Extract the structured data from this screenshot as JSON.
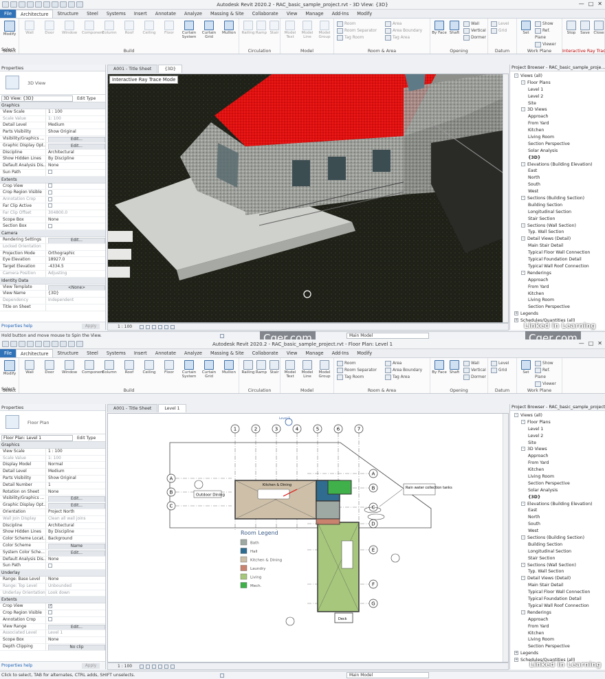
{
  "top": {
    "title": "Autodesk Revit 2020.2 - RAC_basic_sample_project.rvt - 3D View: {3D}",
    "tabs": [
      "File",
      "Architecture",
      "Structure",
      "Steel",
      "Systems",
      "Insert",
      "Annotate",
      "Analyze",
      "Massing & Site",
      "Collaborate",
      "View",
      "Manage",
      "Add-Ins",
      "Modify"
    ],
    "select_label": "Select",
    "modify_label": "Modify",
    "build_tools": [
      "Wall",
      "Door",
      "Window",
      "Component",
      "Column",
      "Roof",
      "Ceiling",
      "Floor",
      "Curtain System",
      "Curtain Grid",
      "Mullion"
    ],
    "build_label": "Build",
    "circ_tools": [
      "Railing",
      "Ramp",
      "Stair"
    ],
    "circ_label": "Circulation",
    "model_tools": [
      "Model Text",
      "Model Line",
      "Model Group"
    ],
    "model_label": "Model",
    "room_small": [
      "Room",
      "Room Separator",
      "Tag Room"
    ],
    "area_small": [
      "Area",
      "Area Boundary",
      "Tag Area"
    ],
    "room_label": "Room & Area",
    "opening_tools": [
      "By Face",
      "Shaft"
    ],
    "opening_small": [
      "Wall",
      "Vertical",
      "Dormer"
    ],
    "opening_label": "Opening",
    "datum_small": [
      "Level",
      "Grid"
    ],
    "datum_label": "Datum",
    "wp_tools": [
      "Set"
    ],
    "wp_small": [
      "Show",
      "Ref. Plane",
      "Viewer"
    ],
    "wp_label": "Work Plane",
    "irt_tools": [
      "Stop",
      "Save",
      "Close"
    ],
    "irt_label": "Interactive Ray Trace",
    "properties_title": "Properties",
    "type_name": "3D View",
    "filter": "3D View: {3D}",
    "edit_type": "Edit Type",
    "rows": [
      {
        "s": "Graphics"
      },
      {
        "k": "View Scale",
        "v": "1 : 100"
      },
      {
        "k": "Scale Value",
        "v": "1: 100",
        "d": true
      },
      {
        "k": "Detail Level",
        "v": "Medium"
      },
      {
        "k": "Parts Visibility",
        "v": "Show Original"
      },
      {
        "k": "Visibility/Graphics ...",
        "b": "Edit..."
      },
      {
        "k": "Graphic Display Opt...",
        "b": "Edit..."
      },
      {
        "k": "Discipline",
        "v": "Architectural"
      },
      {
        "k": "Show Hidden Lines",
        "v": "By Discipline"
      },
      {
        "k": "Default Analysis Dis...",
        "v": "None"
      },
      {
        "k": "Sun Path",
        "c": "off"
      },
      {
        "s": "Extents"
      },
      {
        "k": "Crop View",
        "c": "off"
      },
      {
        "k": "Crop Region Visible",
        "c": "off"
      },
      {
        "k": "Annotation Crop",
        "c": "off",
        "d": true
      },
      {
        "k": "Far Clip Active",
        "c": "off"
      },
      {
        "k": "Far Clip Offset",
        "v": "304800.0",
        "d": true
      },
      {
        "k": "Scope Box",
        "v": "None"
      },
      {
        "k": "Section Box",
        "c": "off"
      },
      {
        "s": "Camera"
      },
      {
        "k": "Rendering Settings",
        "b": "Edit..."
      },
      {
        "k": "Locked Orientation",
        "v": "",
        "d": true
      },
      {
        "k": "Projection Mode",
        "v": "Orthographic"
      },
      {
        "k": "Eye Elevation",
        "v": "18927.0"
      },
      {
        "k": "Target Elevation",
        "v": "-4334.5"
      },
      {
        "k": "Camera Position",
        "v": "Adjusting",
        "d": true
      },
      {
        "s": "Identity Data"
      },
      {
        "k": "View Template",
        "b": "<None>"
      },
      {
        "k": "View Name",
        "v": "{3D}"
      },
      {
        "k": "Dependency",
        "v": "Independent",
        "d": true
      },
      {
        "k": "Title on Sheet",
        "v": ""
      }
    ],
    "help": "Properties help",
    "apply": "Apply",
    "view_tabs": [
      "A001 - Title Sheet",
      "{3D}"
    ],
    "rt_label": "Interactive Ray Trace Mode",
    "scale": "1 : 100",
    "status": "Hold button and move mouse to Spin the View.",
    "main_model": "Main Model",
    "browser_title": "Project Browser - RAC_basic_sample_proje...",
    "tree": [
      {
        "l": 0,
        "t": "Views (all)",
        "g": "-"
      },
      {
        "l": 1,
        "t": "Floor Plans",
        "g": "-"
      },
      {
        "l": 2,
        "t": "Level 1"
      },
      {
        "l": 2,
        "t": "Level 2"
      },
      {
        "l": 2,
        "t": "Site"
      },
      {
        "l": 1,
        "t": "3D Views",
        "g": "-"
      },
      {
        "l": 2,
        "t": "Approach"
      },
      {
        "l": 2,
        "t": "From Yard"
      },
      {
        "l": 2,
        "t": "Kitchen"
      },
      {
        "l": 2,
        "t": "Living Room"
      },
      {
        "l": 2,
        "t": "Section Perspective"
      },
      {
        "l": 2,
        "t": "Solar Analysis"
      },
      {
        "l": 2,
        "t": "{3D}",
        "b": true
      },
      {
        "l": 1,
        "t": "Elevations (Building Elevation)",
        "g": "-"
      },
      {
        "l": 2,
        "t": "East"
      },
      {
        "l": 2,
        "t": "North"
      },
      {
        "l": 2,
        "t": "South"
      },
      {
        "l": 2,
        "t": "West"
      },
      {
        "l": 1,
        "t": "Sections (Building Section)",
        "g": "-"
      },
      {
        "l": 2,
        "t": "Building Section"
      },
      {
        "l": 2,
        "t": "Longitudinal Section"
      },
      {
        "l": 2,
        "t": "Stair Section"
      },
      {
        "l": 1,
        "t": "Sections (Wall Section)",
        "g": "-"
      },
      {
        "l": 2,
        "t": "Typ. Wall Section"
      },
      {
        "l": 1,
        "t": "Detail Views (Detail)",
        "g": "-"
      },
      {
        "l": 2,
        "t": "Main Stair Detail"
      },
      {
        "l": 2,
        "t": "Typical Floor Wall Connection"
      },
      {
        "l": 2,
        "t": "Typical Foundation Detail"
      },
      {
        "l": 2,
        "t": "Typical Wall Roof Connection"
      },
      {
        "l": 1,
        "t": "Renderings",
        "g": "-"
      },
      {
        "l": 2,
        "t": "Approach"
      },
      {
        "l": 2,
        "t": "From Yard"
      },
      {
        "l": 2,
        "t": "Kitchen"
      },
      {
        "l": 2,
        "t": "Living Room"
      },
      {
        "l": 2,
        "t": "Section Perspective"
      },
      {
        "l": 0,
        "t": "Legends",
        "g": "+"
      },
      {
        "l": 0,
        "t": "Schedules/Quantities (all)",
        "g": "+"
      }
    ]
  },
  "bottom": {
    "title": "Autodesk Revit 2020.2 - RAC_basic_sample_project.rvt - Floor Plan: Level 1",
    "properties_title": "Properties",
    "type_name": "Floor Plan",
    "filter": "Floor Plan: Level 1",
    "edit_type": "Edit Type",
    "rows": [
      {
        "s": "Graphics"
      },
      {
        "k": "View Scale",
        "v": "1 : 100"
      },
      {
        "k": "Scale Value",
        "v": "1: 100",
        "d": true
      },
      {
        "k": "Display Model",
        "v": "Normal"
      },
      {
        "k": "Detail Level",
        "v": "Medium"
      },
      {
        "k": "Parts Visibility",
        "v": "Show Original"
      },
      {
        "k": "Detail Number",
        "v": "1"
      },
      {
        "k": "Rotation on Sheet",
        "v": "None"
      },
      {
        "k": "Visibility/Graphics ...",
        "b": "Edit..."
      },
      {
        "k": "Graphic Display Opt...",
        "b": "Edit..."
      },
      {
        "k": "Orientation",
        "v": "Project North"
      },
      {
        "k": "Wall Join Display",
        "v": "Clean all wall joins",
        "d": true
      },
      {
        "k": "Discipline",
        "v": "Architectural"
      },
      {
        "k": "Show Hidden Lines",
        "v": "By Discipline"
      },
      {
        "k": "Color Scheme Locat...",
        "v": "Background"
      },
      {
        "k": "Color Scheme",
        "b": "Name"
      },
      {
        "k": "System Color Sche...",
        "b": "Edit..."
      },
      {
        "k": "Default Analysis Dis...",
        "v": "None"
      },
      {
        "k": "Sun Path",
        "c": "off"
      },
      {
        "s": "Underlay"
      },
      {
        "k": "Range: Base Level",
        "v": "None"
      },
      {
        "k": "Range: Top Level",
        "v": "Unbounded",
        "d": true
      },
      {
        "k": "Underlay Orientation",
        "v": "Look down",
        "d": true
      },
      {
        "s": "Extents"
      },
      {
        "k": "Crop View",
        "c": "on"
      },
      {
        "k": "Crop Region Visible",
        "c": "off"
      },
      {
        "k": "Annotation Crop",
        "c": "off"
      },
      {
        "k": "View Range",
        "b": "Edit..."
      },
      {
        "k": "Associated Level",
        "v": "Level 1",
        "d": true
      },
      {
        "k": "Scope Box",
        "v": "None"
      },
      {
        "k": "Depth Clipping",
        "b": "No clip"
      }
    ],
    "help": "Properties help",
    "apply": "Apply",
    "view_tabs": [
      "A001 - Title Sheet",
      "Level 1"
    ],
    "scale": "1 : 100",
    "status": "Click to select, TAB for alternates, CTRL adds, SHIFT unselects.",
    "main_model": "Main Model",
    "browser_title": "Project Browser - RAC_basic_sample_project.rvt",
    "legend_title": "Room Legend",
    "legend": [
      {
        "name": "Bath",
        "color": "#9fa9a3"
      },
      {
        "name": "Hall",
        "color": "#2f6c8f"
      },
      {
        "name": "Kitchen & Dining",
        "color": "#cdbfa8"
      },
      {
        "name": "Laundry",
        "color": "#c9826d"
      },
      {
        "name": "Living",
        "color": "#a7c77c"
      },
      {
        "name": "Mech.",
        "color": "#3fb04a"
      }
    ],
    "grid_cols": [
      "1",
      "2",
      "3",
      "4",
      "5",
      "6",
      "7"
    ],
    "grid_rows_left": [
      "A",
      "B",
      "C"
    ],
    "grid_rows_right": [
      "A",
      "B",
      "C",
      "D",
      "E",
      "F",
      "G"
    ],
    "tags": [
      "Outdoor Dining",
      "Kitchen & Dining",
      "Rain water collection tanks",
      "Deck"
    ],
    "level_tag": "Level 1"
  },
  "watermark": "Cger.com",
  "linkedin": "Linked in Learning"
}
